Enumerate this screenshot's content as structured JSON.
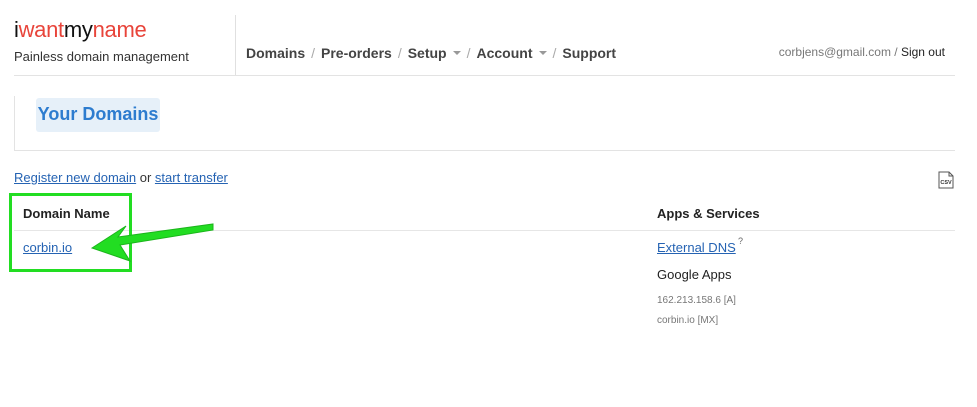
{
  "header": {
    "logo": {
      "part1": "i",
      "part2": "want",
      "part3": "my",
      "part4": "name",
      "colors": {
        "dark": "#111111",
        "accent": "#e8443a"
      }
    },
    "tagline": "Painless domain management",
    "nav": [
      {
        "label": "Domains"
      },
      {
        "label": "Pre-orders"
      },
      {
        "label": "Setup"
      },
      {
        "label": "Account"
      },
      {
        "label": "Support"
      }
    ],
    "user_email": "corbjens@gmail.com",
    "separator": " / ",
    "signout_label": "Sign out"
  },
  "page": {
    "title": "Your Domains",
    "register_link": "Register new domain",
    "or_text": " or ",
    "transfer_link": "start transfer",
    "csv_icon": "csv-export-icon"
  },
  "table": {
    "headers": {
      "domain": "Domain Name",
      "apps": "Apps & Services"
    },
    "rows": [
      {
        "domain": "corbin.io",
        "external_dns": "External DNS",
        "help_mark": "?",
        "app": "Google Apps",
        "records": [
          "162.213.158.6 [A]",
          "corbin.io [MX]"
        ]
      }
    ]
  },
  "annotation": {
    "color": "#22dd22"
  }
}
